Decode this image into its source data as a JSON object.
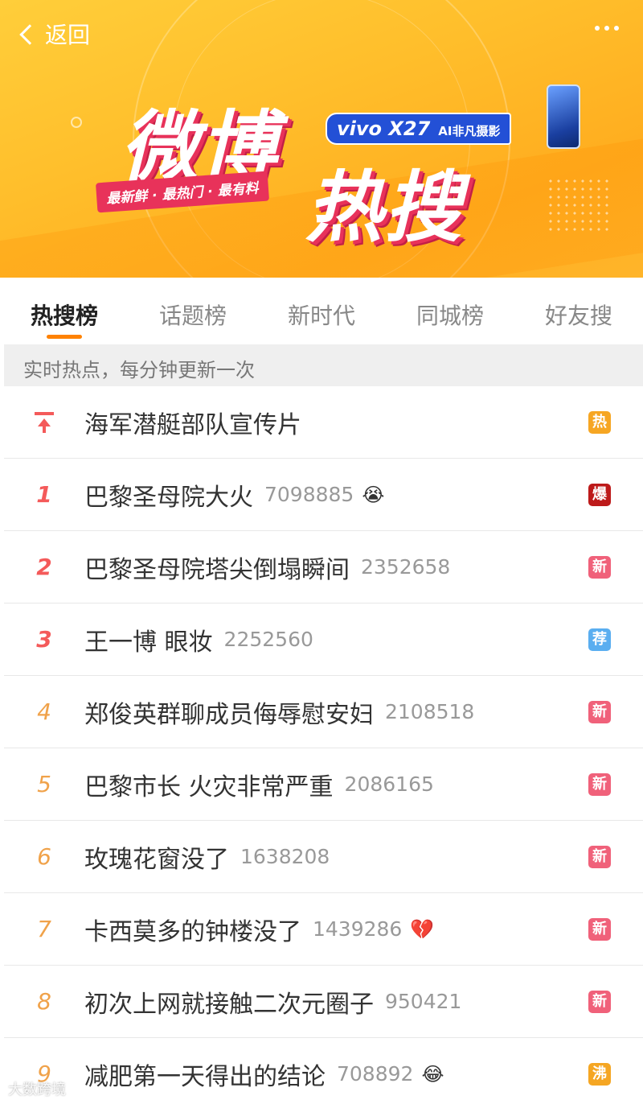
{
  "header": {
    "back_label": "返回",
    "banner": {
      "logo_text_1": "微博",
      "logo_text_2": "热搜",
      "slogan": "最新鲜 · 最热门 · 最有料",
      "sponsor_model": "vivo X27",
      "sponsor_tagline": "AI非凡摄影"
    }
  },
  "tabs": [
    {
      "label": "热搜榜",
      "active": true
    },
    {
      "label": "话题榜",
      "active": false
    },
    {
      "label": "新时代",
      "active": false
    },
    {
      "label": "同城榜",
      "active": false
    },
    {
      "label": "好友搜",
      "active": false
    }
  ],
  "notice": "实时热点，每分钟更新一次",
  "list": [
    {
      "rank": "",
      "title": "海军潜艇部队宣传片",
      "count": "",
      "emoji": "",
      "badge": "热",
      "badge_color": "#f6a623"
    },
    {
      "rank": "1",
      "title": "巴黎圣母院大火",
      "count": "7098885",
      "emoji": "😭",
      "badge": "爆",
      "badge_color": "#bd1a1a"
    },
    {
      "rank": "2",
      "title": "巴黎圣母院塔尖倒塌瞬间",
      "count": "2352658",
      "emoji": "",
      "badge": "新",
      "badge_color": "#f0617a"
    },
    {
      "rank": "3",
      "title": "王一博 眼妆",
      "count": "2252560",
      "emoji": "",
      "badge": "荐",
      "badge_color": "#5aaef0"
    },
    {
      "rank": "4",
      "title": "郑俊英群聊成员侮辱慰安妇",
      "count": "2108518",
      "emoji": "",
      "badge": "新",
      "badge_color": "#f0617a"
    },
    {
      "rank": "5",
      "title": "巴黎市长 火灾非常严重",
      "count": "2086165",
      "emoji": "",
      "badge": "新",
      "badge_color": "#f0617a"
    },
    {
      "rank": "6",
      "title": "玫瑰花窗没了",
      "count": "1638208",
      "emoji": "",
      "badge": "新",
      "badge_color": "#f0617a"
    },
    {
      "rank": "7",
      "title": "卡西莫多的钟楼没了",
      "count": "1439286",
      "emoji": "💔",
      "badge": "新",
      "badge_color": "#f0617a"
    },
    {
      "rank": "8",
      "title": "初次上网就接触二次元圈子",
      "count": "950421",
      "emoji": "",
      "badge": "新",
      "badge_color": "#f0617a"
    },
    {
      "rank": "9",
      "title": "减肥第一天得出的结论",
      "count": "708892",
      "emoji": "😂",
      "badge": "沸",
      "badge_color": "#f5a623"
    }
  ],
  "watermark": "大数跨境"
}
